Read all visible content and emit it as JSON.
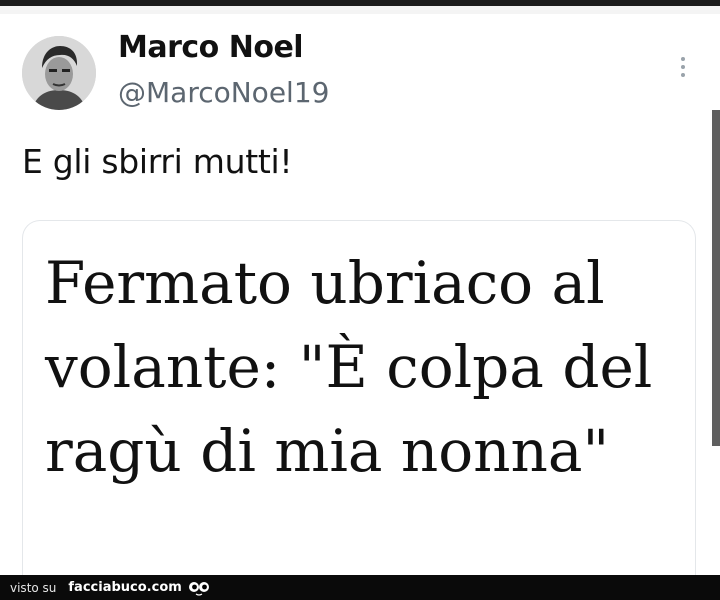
{
  "tweet": {
    "author": {
      "display_name": "Marco Noel",
      "handle": "@MarcoNoel19",
      "avatar_icon": "avatar-photo"
    },
    "more_icon": "more-vertical-icon",
    "text": "E gli sbirri mutti!",
    "card": {
      "headline": "Fermato ubriaco al volante: \"È colpa del ragù di mia nonna\""
    }
  },
  "footer": {
    "prefix": "visto su",
    "site": "facciabuco.com",
    "logo_icon": "eyes-icon"
  },
  "colors": {
    "handle": "#5c6670",
    "text": "#111111",
    "footer_bg": "#0a0a0a"
  }
}
